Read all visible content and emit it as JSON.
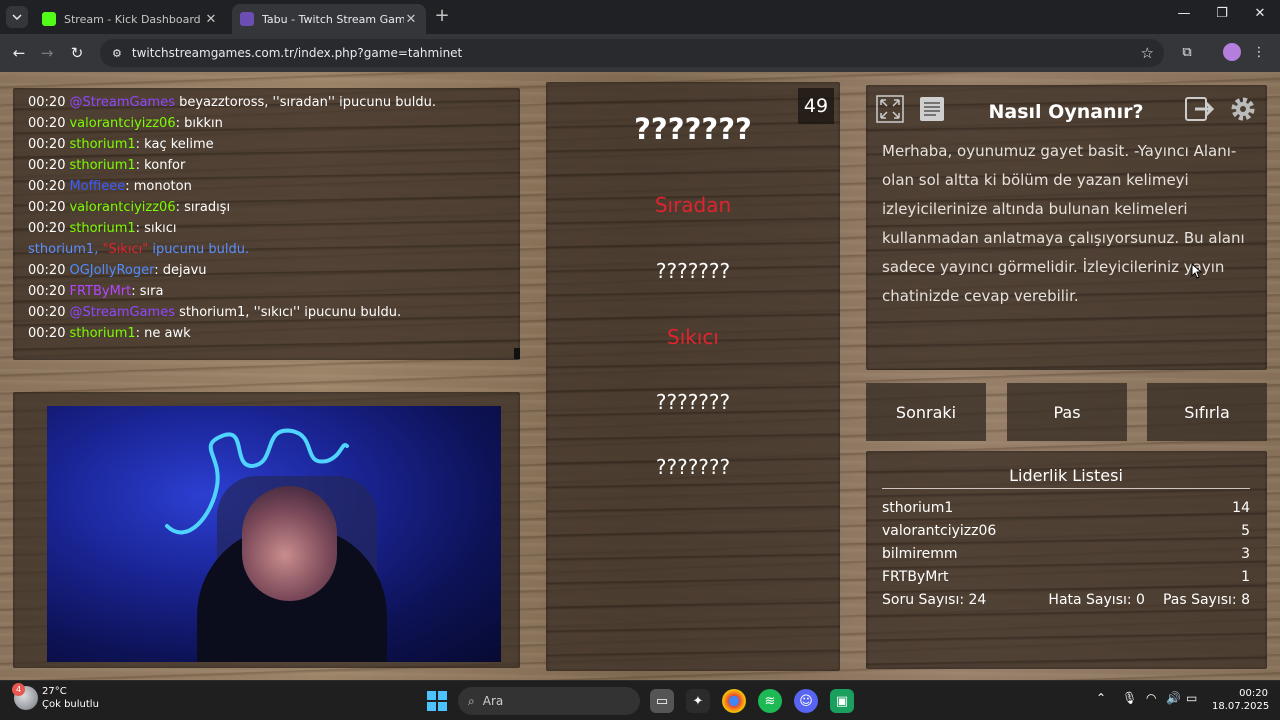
{
  "browser": {
    "tabs": [
      {
        "title": "Stream - Kick Dashboard",
        "active": false,
        "favicon_color": "#53fc18"
      },
      {
        "title": "Tabu - Twitch Stream Games",
        "active": true,
        "favicon_color": "#6b4db3"
      }
    ],
    "url": "twitchstreamgames.com.tr/index.php?game=tahminet"
  },
  "chat": {
    "colors": {
      "streamgames": "#9146ff",
      "valorant": "#7cfc00",
      "sthorium": "#7cfc00",
      "moffieee": "#3b5cff",
      "ogjolly": "#4f8cff",
      "frtbymrt": "#b347ff",
      "notice": "#5b8fff",
      "hint": "#e0242f"
    },
    "lines": [
      {
        "time": "00:20",
        "user": "@StreamGames",
        "color": "streamgames",
        "sep": " ",
        "msg": "beyazztoross, ''sıradan'' ipucunu buldu."
      },
      {
        "time": "00:20",
        "user": "valorantciyizz06",
        "color": "valorant",
        "sep": ": ",
        "msg": "bıkkın"
      },
      {
        "time": "00:20",
        "user": "sthorium1",
        "color": "sthorium",
        "sep": ": ",
        "msg": "kaç kelime"
      },
      {
        "time": "00:20",
        "user": "sthorium1",
        "color": "sthorium",
        "sep": ": ",
        "msg": "konfor"
      },
      {
        "time": "00:20",
        "user": "Moffieee",
        "color": "moffieee",
        "sep": ": ",
        "msg": "monoton"
      },
      {
        "time": "00:20",
        "user": "valorantciyizz06",
        "color": "valorant",
        "sep": ": ",
        "msg": "sıradışı"
      },
      {
        "time": "00:20",
        "user": "sthorium1",
        "color": "sthorium",
        "sep": ": ",
        "msg": "sıkıcı"
      },
      {
        "time": "00:20",
        "user": "OGJollyRoger",
        "color": "ogjolly",
        "sep": ": ",
        "msg": "dejavu"
      },
      {
        "time": "00:20",
        "user": "FRTByMrt",
        "color": "frtbymrt",
        "sep": ": ",
        "msg": "sıra"
      },
      {
        "time": "00:20",
        "user": "@StreamGames",
        "color": "streamgames",
        "sep": " ",
        "msg": "sthorium1, ''sıkıcı'' ipucunu buldu."
      },
      {
        "time": "00:20",
        "user": "sthorium1",
        "color": "sthorium",
        "sep": ": ",
        "msg": "ne awk"
      }
    ],
    "notice": {
      "user": "sthorium1,",
      "word": "\"Sıkıcı\"",
      "rest": "ipucunu buldu."
    }
  },
  "game": {
    "timer": "49",
    "main_word": "???????",
    "hints": [
      "Sıradan",
      "???????",
      "Sıkıcı",
      "???????",
      "???????"
    ]
  },
  "info": {
    "title": "Nasıl Oynanır?",
    "text": "Merhaba, oyunumuz gayet basit. -Yayıncı Alanı- olan sol altta ki bölüm de yazan kelimeyi izleyicilerinize altında bulunan kelimeleri kullanmadan anlatmaya çalışıyorsunuz. Bu alanı sadece yayıncı görmelidir. İzleyicileriniz yayın chatinizde cevap verebilir."
  },
  "actions": {
    "next": "Sonraki",
    "pass": "Pas",
    "reset": "Sıfırla"
  },
  "leaderboard": {
    "title": "Liderlik Listesi",
    "rows": [
      {
        "name": "sthorium1",
        "score": "14"
      },
      {
        "name": "valorantciyizz06",
        "score": "5"
      },
      {
        "name": "bilmiremm",
        "score": "3"
      },
      {
        "name": "FRTByMrt",
        "score": "1"
      }
    ],
    "stats": {
      "questions": "Soru Sayısı: 24",
      "errors": "Hata Sayısı: 0",
      "passes": "Pas Sayısı: 8"
    }
  },
  "taskbar": {
    "weather": {
      "temp": "27°C",
      "desc": "Çok bulutlu",
      "badge": "4"
    },
    "search_placeholder": "Ara",
    "time": "00:20",
    "date": "18.07.2025"
  }
}
